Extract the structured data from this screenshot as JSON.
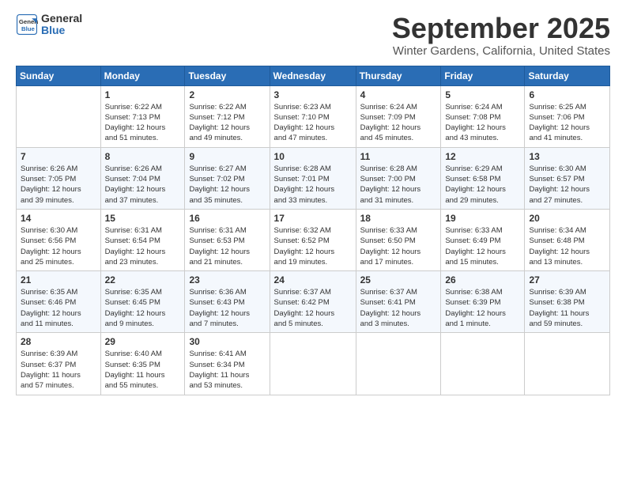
{
  "header": {
    "logo_general": "General",
    "logo_blue": "Blue",
    "month": "September 2025",
    "location": "Winter Gardens, California, United States"
  },
  "days_of_week": [
    "Sunday",
    "Monday",
    "Tuesday",
    "Wednesday",
    "Thursday",
    "Friday",
    "Saturday"
  ],
  "weeks": [
    [
      {
        "day": "",
        "info": ""
      },
      {
        "day": "1",
        "info": "Sunrise: 6:22 AM\nSunset: 7:13 PM\nDaylight: 12 hours\nand 51 minutes."
      },
      {
        "day": "2",
        "info": "Sunrise: 6:22 AM\nSunset: 7:12 PM\nDaylight: 12 hours\nand 49 minutes."
      },
      {
        "day": "3",
        "info": "Sunrise: 6:23 AM\nSunset: 7:10 PM\nDaylight: 12 hours\nand 47 minutes."
      },
      {
        "day": "4",
        "info": "Sunrise: 6:24 AM\nSunset: 7:09 PM\nDaylight: 12 hours\nand 45 minutes."
      },
      {
        "day": "5",
        "info": "Sunrise: 6:24 AM\nSunset: 7:08 PM\nDaylight: 12 hours\nand 43 minutes."
      },
      {
        "day": "6",
        "info": "Sunrise: 6:25 AM\nSunset: 7:06 PM\nDaylight: 12 hours\nand 41 minutes."
      }
    ],
    [
      {
        "day": "7",
        "info": "Sunrise: 6:26 AM\nSunset: 7:05 PM\nDaylight: 12 hours\nand 39 minutes."
      },
      {
        "day": "8",
        "info": "Sunrise: 6:26 AM\nSunset: 7:04 PM\nDaylight: 12 hours\nand 37 minutes."
      },
      {
        "day": "9",
        "info": "Sunrise: 6:27 AM\nSunset: 7:02 PM\nDaylight: 12 hours\nand 35 minutes."
      },
      {
        "day": "10",
        "info": "Sunrise: 6:28 AM\nSunset: 7:01 PM\nDaylight: 12 hours\nand 33 minutes."
      },
      {
        "day": "11",
        "info": "Sunrise: 6:28 AM\nSunset: 7:00 PM\nDaylight: 12 hours\nand 31 minutes."
      },
      {
        "day": "12",
        "info": "Sunrise: 6:29 AM\nSunset: 6:58 PM\nDaylight: 12 hours\nand 29 minutes."
      },
      {
        "day": "13",
        "info": "Sunrise: 6:30 AM\nSunset: 6:57 PM\nDaylight: 12 hours\nand 27 minutes."
      }
    ],
    [
      {
        "day": "14",
        "info": "Sunrise: 6:30 AM\nSunset: 6:56 PM\nDaylight: 12 hours\nand 25 minutes."
      },
      {
        "day": "15",
        "info": "Sunrise: 6:31 AM\nSunset: 6:54 PM\nDaylight: 12 hours\nand 23 minutes."
      },
      {
        "day": "16",
        "info": "Sunrise: 6:31 AM\nSunset: 6:53 PM\nDaylight: 12 hours\nand 21 minutes."
      },
      {
        "day": "17",
        "info": "Sunrise: 6:32 AM\nSunset: 6:52 PM\nDaylight: 12 hours\nand 19 minutes."
      },
      {
        "day": "18",
        "info": "Sunrise: 6:33 AM\nSunset: 6:50 PM\nDaylight: 12 hours\nand 17 minutes."
      },
      {
        "day": "19",
        "info": "Sunrise: 6:33 AM\nSunset: 6:49 PM\nDaylight: 12 hours\nand 15 minutes."
      },
      {
        "day": "20",
        "info": "Sunrise: 6:34 AM\nSunset: 6:48 PM\nDaylight: 12 hours\nand 13 minutes."
      }
    ],
    [
      {
        "day": "21",
        "info": "Sunrise: 6:35 AM\nSunset: 6:46 PM\nDaylight: 12 hours\nand 11 minutes."
      },
      {
        "day": "22",
        "info": "Sunrise: 6:35 AM\nSunset: 6:45 PM\nDaylight: 12 hours\nand 9 minutes."
      },
      {
        "day": "23",
        "info": "Sunrise: 6:36 AM\nSunset: 6:43 PM\nDaylight: 12 hours\nand 7 minutes."
      },
      {
        "day": "24",
        "info": "Sunrise: 6:37 AM\nSunset: 6:42 PM\nDaylight: 12 hours\nand 5 minutes."
      },
      {
        "day": "25",
        "info": "Sunrise: 6:37 AM\nSunset: 6:41 PM\nDaylight: 12 hours\nand 3 minutes."
      },
      {
        "day": "26",
        "info": "Sunrise: 6:38 AM\nSunset: 6:39 PM\nDaylight: 12 hours\nand 1 minute."
      },
      {
        "day": "27",
        "info": "Sunrise: 6:39 AM\nSunset: 6:38 PM\nDaylight: 11 hours\nand 59 minutes."
      }
    ],
    [
      {
        "day": "28",
        "info": "Sunrise: 6:39 AM\nSunset: 6:37 PM\nDaylight: 11 hours\nand 57 minutes."
      },
      {
        "day": "29",
        "info": "Sunrise: 6:40 AM\nSunset: 6:35 PM\nDaylight: 11 hours\nand 55 minutes."
      },
      {
        "day": "30",
        "info": "Sunrise: 6:41 AM\nSunset: 6:34 PM\nDaylight: 11 hours\nand 53 minutes."
      },
      {
        "day": "",
        "info": ""
      },
      {
        "day": "",
        "info": ""
      },
      {
        "day": "",
        "info": ""
      },
      {
        "day": "",
        "info": ""
      }
    ]
  ]
}
